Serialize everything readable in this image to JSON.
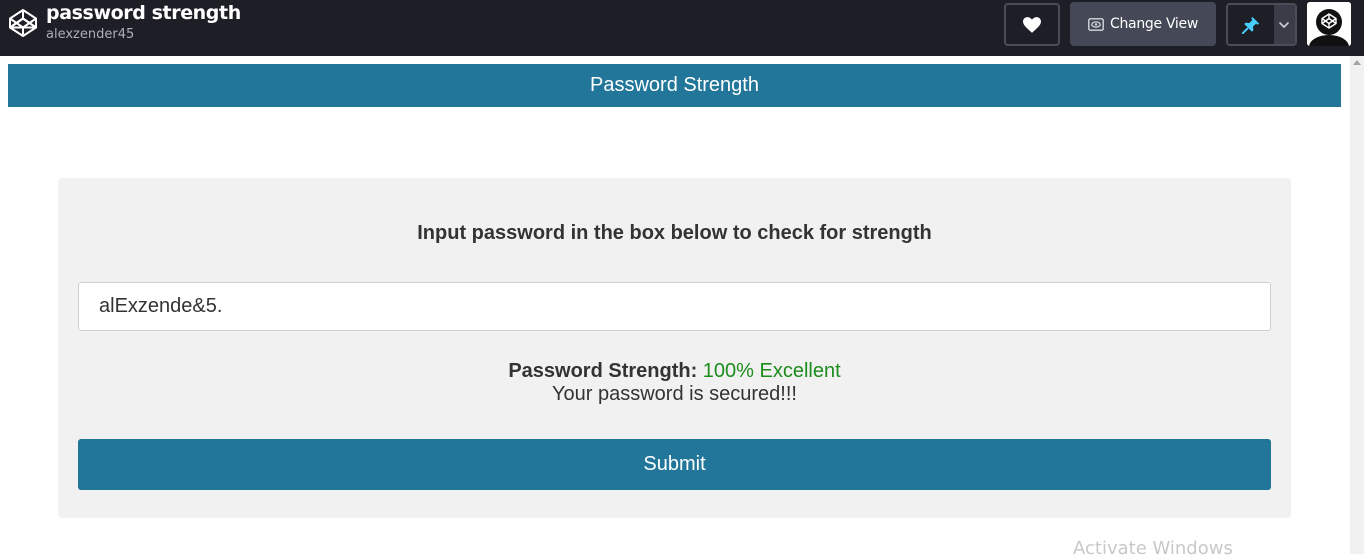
{
  "topbar": {
    "pen_title": "password strength",
    "author": "alexzender45",
    "change_view_label": "Change View",
    "logo_icon": "codepen-logo-icon",
    "heart_icon": "heart-icon",
    "change_view_icon": "eye-icon",
    "pin_icon": "pin-icon",
    "dropdown_icon": "chevron-down-icon",
    "colors": {
      "background": "#1e1f26",
      "pin": "#47cfff"
    }
  },
  "app": {
    "header_title": "Password Strength",
    "instruction": "Input password in the box below to check for strength",
    "password_value": "alExzende&5.",
    "strength_label": "Password Strength:",
    "strength_value": "100% Excellent",
    "secured_message": "Your password is secured!!!",
    "submit_label": "Submit",
    "colors": {
      "primary": "#217699",
      "success": "#1c8c1c",
      "card": "#f1f1f1"
    }
  },
  "os_overlay": {
    "watermark": "Activate Windows"
  }
}
